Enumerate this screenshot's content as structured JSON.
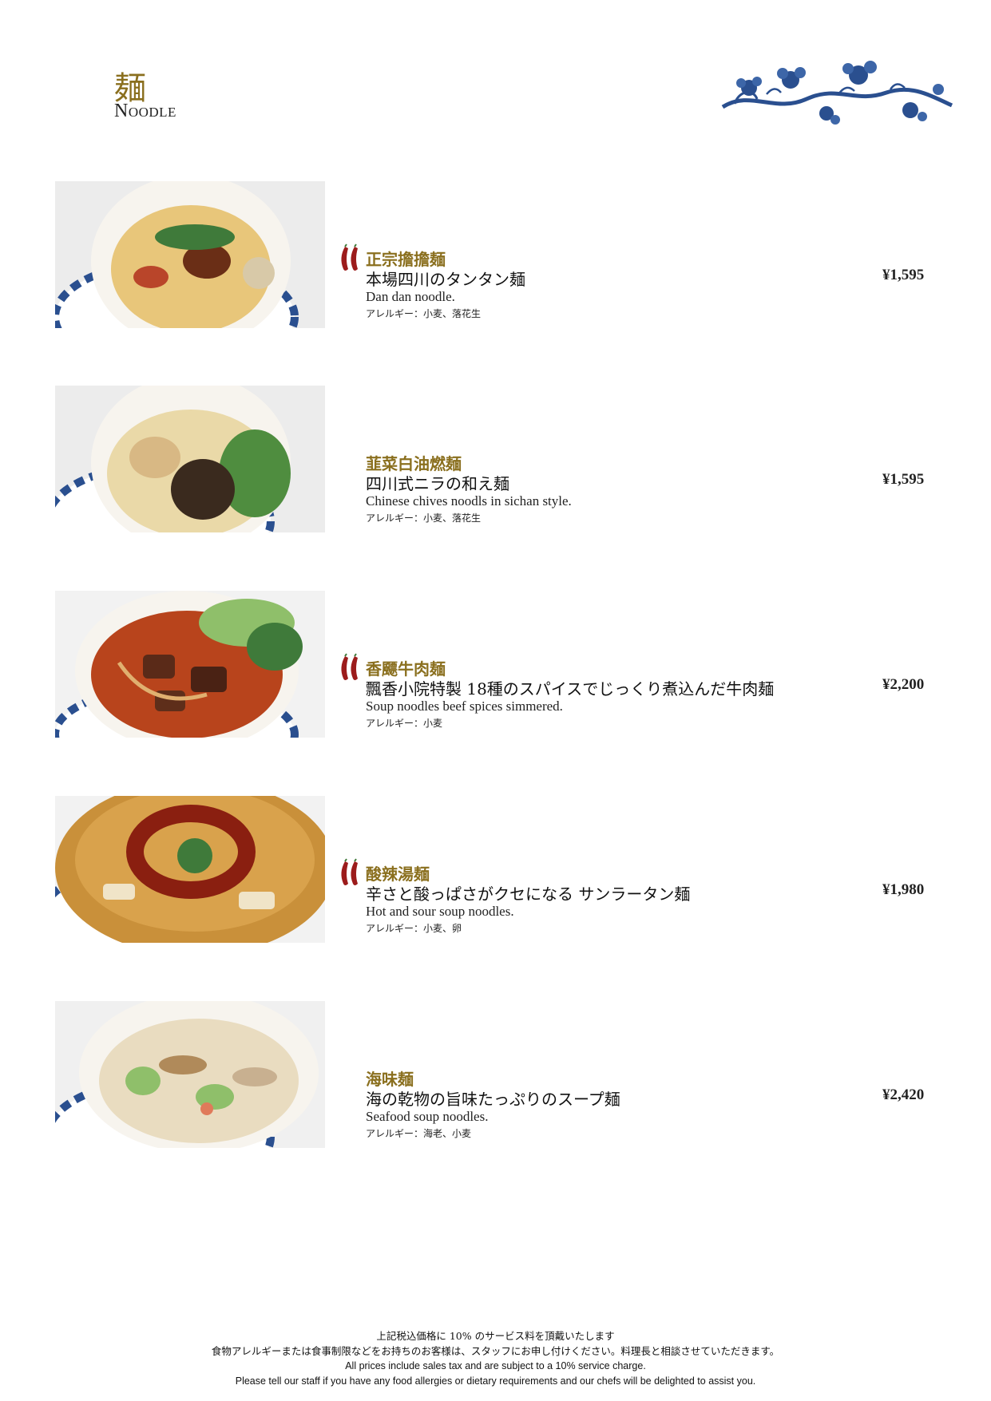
{
  "header": {
    "title_kanji": "麺",
    "title_en": "Noodle"
  },
  "items": [
    {
      "name_cn": "正宗擔擔麺",
      "name_jp": "本場四川のタンタン麺",
      "name_en": "Dan dan noodle.",
      "allergy": "アレルギー：小麦、落花生",
      "price": "¥1,595",
      "spicy": true,
      "photo_icon": "dan-dan-noodle-photo"
    },
    {
      "name_cn": "韮菜白油燃麺",
      "name_jp": "四川式ニラの和え麺",
      "name_en": "Chinese chives noodls in sichan style.",
      "allergy": "アレルギー：小麦、落花生",
      "price": "¥1,595",
      "spicy": false,
      "photo_icon": "chive-noodle-photo"
    },
    {
      "name_cn": "香飃牛肉麺",
      "name_jp": "飄香小院特製 18種のスパイスでじっくり煮込んだ牛肉麺",
      "name_en": "Soup noodles beef spices simmered.",
      "allergy": "アレルギー：小麦",
      "price": "¥2,200",
      "spicy": true,
      "photo_icon": "beef-noodle-photo"
    },
    {
      "name_cn": "酸辣湯麺",
      "name_jp": "辛さと酸っぱさがクセになる サンラータン麺",
      "name_en": "Hot and sour soup noodles.",
      "allergy": "アレルギー：小麦、卵",
      "price": "¥1,980",
      "spicy": true,
      "photo_icon": "hot-sour-noodle-photo"
    },
    {
      "name_cn": "海味麺",
      "name_jp": "海の乾物の旨味たっぷりのスープ麺",
      "name_en": "Seafood soup noodles.",
      "allergy": "アレルギー：海老、小麦",
      "price": "¥2,420",
      "spicy": false,
      "photo_icon": "seafood-noodle-photo"
    }
  ],
  "footer": {
    "line1": "上記税込価格に 10% のサービス料を頂戴いたします",
    "line2": "食物アレルギーまたは食事制限などをお持ちのお客様は、スタッフにお申し付けください。料理長と相談させていただきます。",
    "line3": "All prices include sales tax and are subject to a 10% service charge.",
    "line4": "Please tell our staff if you have any food allergies or dietary requirements and our chefs will be delighted to assist you."
  },
  "colors": {
    "accent_gold": "#8a6f1e",
    "chili_red": "#9c1c1c",
    "porcelain_blue": "#2a4f8f"
  }
}
